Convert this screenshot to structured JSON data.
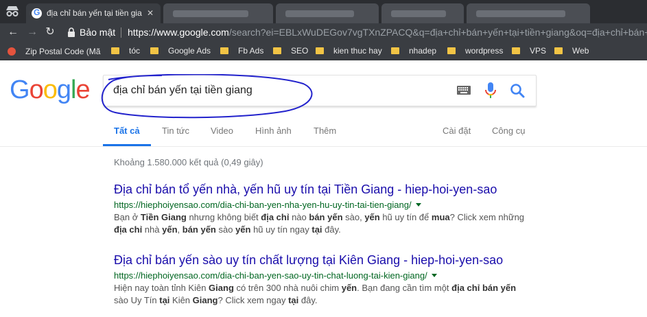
{
  "tabs": [
    {
      "title": "địa chỉ bán yến tại tiền gia",
      "active": true
    },
    {
      "title": "",
      "active": false
    },
    {
      "title": "",
      "active": false
    },
    {
      "title": "",
      "active": false
    },
    {
      "title": "",
      "active": false
    }
  ],
  "toolbar": {
    "secure_label": "Bảo mật",
    "url_host": "https://www.google.com",
    "url_rest": "/search?ei=EBLxWuDEGov7vgTXnZPACQ&q=địa+chỉ+bán+yến+tại+tiền+giang&oq=địa+chỉ+bán+"
  },
  "bookmarks": [
    {
      "label": "Zip Postal Code (Mã",
      "icon": "zip-icon"
    },
    {
      "label": "tóc",
      "icon": "folder-icon"
    },
    {
      "label": "Google Ads",
      "icon": "folder-icon"
    },
    {
      "label": "Fb Ads",
      "icon": "folder-icon"
    },
    {
      "label": "SEO",
      "icon": "folder-icon"
    },
    {
      "label": "kien thuc hay",
      "icon": "folder-icon"
    },
    {
      "label": "nhadep",
      "icon": "folder-icon"
    },
    {
      "label": "wordpress",
      "icon": "folder-icon"
    },
    {
      "label": "VPS",
      "icon": "folder-icon"
    },
    {
      "label": "Web",
      "icon": "folder-icon"
    }
  ],
  "search": {
    "query": "địa chỉ bán yến tại tiền giang"
  },
  "search_tabs": {
    "all": "Tất cả",
    "news": "Tin tức",
    "video": "Video",
    "images": "Hình ảnh",
    "more": "Thêm",
    "settings": "Cài đặt",
    "tools": "Công cụ"
  },
  "stats": "Khoảng 1.580.000 kết quả (0,49 giây)",
  "results": [
    {
      "title": "Địa chỉ bán tổ yến nhà, yến hũ uy tín tại Tiền Giang - hiep-hoi-yen-sao",
      "url": "https://hiephoiyensao.com/dia-chi-ban-yen-nha-yen-hu-uy-tin-tai-tien-giang/",
      "snippet_html": "Bạn ở <b>Tiền Giang</b> nhưng không biết <b>địa chỉ</b> nào <b>bán yến</b> sào, <b>yến</b> hũ uy tín để <b>mua</b>? Click xem những <b>địa chỉ</b> nhà <b>yến</b>, <b>bán yến</b> sào <b>yến</b> hũ uy tín ngay <b>tại</b> đây."
    },
    {
      "title": "Địa chỉ bán yến sào uy tín chất lượng tại Kiên Giang - hiep-hoi-yen-sao",
      "url": "https://hiephoiyensao.com/dia-chi-ban-yen-sao-uy-tin-chat-luong-tai-kien-giang/",
      "snippet_html": "Hiện nay toàn tỉnh Kiên <b>Giang</b> có trên 300 nhà nuôi chim <b>yến</b>. Bạn đang cần tìm một <b>địa chỉ bán yến</b> sào Uy Tín <b>tại</b> Kiên <b>Giang</b>? Click xem ngay <b>tại</b> đây."
    }
  ],
  "colors": {
    "link": "#1a0dab",
    "url_green": "#006621",
    "accent_blue": "#1a73e8",
    "annotation_circle": "#2222cc"
  }
}
